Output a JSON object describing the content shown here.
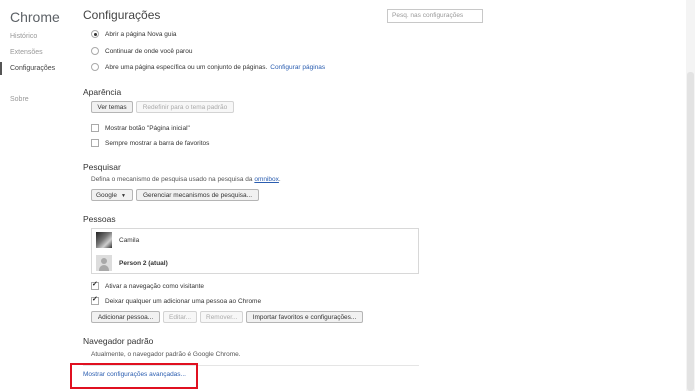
{
  "sidebar": {
    "brand": "Chrome",
    "items": [
      {
        "label": "Histórico"
      },
      {
        "label": "Extensões"
      },
      {
        "label": "Configurações"
      },
      {
        "label": "Sobre"
      }
    ]
  },
  "header": {
    "title": "Configurações",
    "search_placeholder": "Pesq. nas configurações"
  },
  "startup": {
    "options": [
      {
        "label": "Abrir a página Nova guia",
        "selected": true
      },
      {
        "label": "Continuar de onde você parou",
        "selected": false
      },
      {
        "label": "Abre uma página específica ou um conjunto de páginas.",
        "link": "Configurar páginas",
        "selected": false
      }
    ]
  },
  "appearance": {
    "title": "Aparência",
    "themes_button": "Ver temas",
    "reset_button": "Redefinir para o tema padrão",
    "show_home": "Mostrar botão \"Página inicial\"",
    "show_bookmarks": "Sempre mostrar a barra de favoritos"
  },
  "search": {
    "title": "Pesquisar",
    "description": "Defina o mecanismo de pesquisa usado na pesquisa da",
    "description_link": "omnibox",
    "description_end": ".",
    "engine": "Google",
    "manage_button": "Gerenciar mecanismos de pesquisa..."
  },
  "people": {
    "title": "Pessoas",
    "profiles": [
      {
        "name": "Camila"
      },
      {
        "name": "Person 2 (atual)"
      }
    ],
    "guest": "Ativar a navegação como visitante",
    "anyone_add": "Deixar qualquer um adicionar uma pessoa ao Chrome",
    "add_button": "Adicionar pessoa...",
    "edit_button": "Editar...",
    "remove_button": "Remover...",
    "import_button": "Importar favoritos e configurações..."
  },
  "default_browser": {
    "title": "Navegador padrão",
    "status": "Atualmente, o navegador padrão é Google Chrome."
  },
  "advanced_link": "Mostrar configurações avançadas...",
  "colors": {
    "link": "#2a5db0",
    "highlight": "#e01020"
  }
}
